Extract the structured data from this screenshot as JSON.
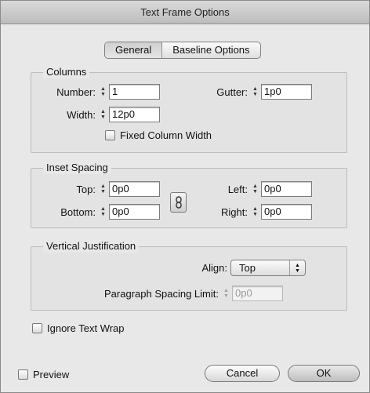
{
  "window": {
    "title": "Text Frame Options"
  },
  "tabs": [
    {
      "label": "General",
      "active": true
    },
    {
      "label": "Baseline Options",
      "active": false
    }
  ],
  "columns": {
    "title": "Columns",
    "number_label": "Number:",
    "number_value": "1",
    "gutter_label": "Gutter:",
    "gutter_value": "1p0",
    "width_label": "Width:",
    "width_value": "12p0",
    "fixed_label": "Fixed Column Width"
  },
  "inset": {
    "title": "Inset Spacing",
    "top_label": "Top:",
    "top_value": "0p0",
    "bottom_label": "Bottom:",
    "bottom_value": "0p0",
    "left_label": "Left:",
    "left_value": "0p0",
    "right_label": "Right:",
    "right_value": "0p0"
  },
  "vertical": {
    "title": "Vertical Justification",
    "align_label": "Align:",
    "align_value": "Top",
    "para_label": "Paragraph Spacing Limit:",
    "para_value": "0p0"
  },
  "ignore_wrap_label": "Ignore Text Wrap",
  "footer": {
    "preview_label": "Preview",
    "cancel_label": "Cancel",
    "ok_label": "OK"
  }
}
